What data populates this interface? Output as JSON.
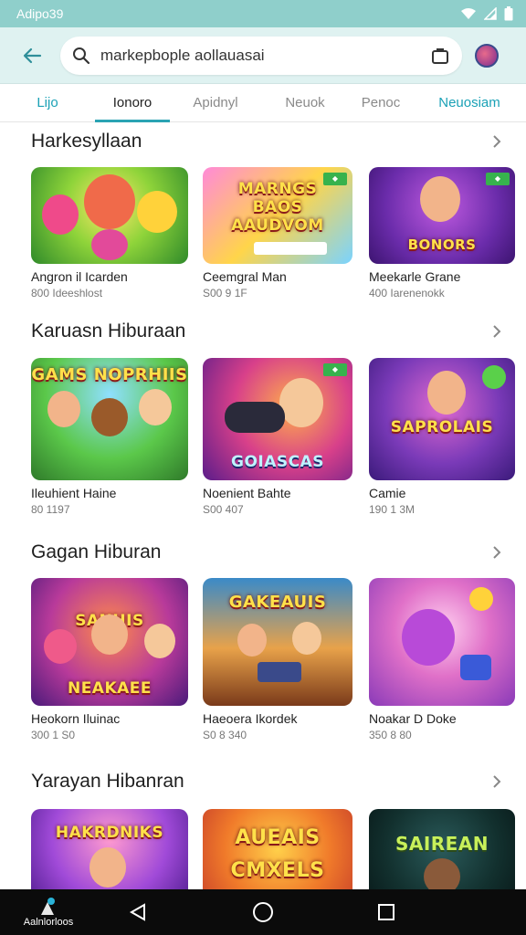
{
  "status_bar": {
    "time": "Adipo39"
  },
  "search": {
    "value": "markepbople aollauasai"
  },
  "tabs": [
    {
      "label": "Lijo"
    },
    {
      "label": "Ionoro"
    },
    {
      "label": "Apidnyl"
    },
    {
      "label": "Neuok"
    },
    {
      "label": "Penoc"
    },
    {
      "label": "Neuosiam"
    }
  ],
  "sections": [
    {
      "title": "Harkesyllaan",
      "cards": [
        {
          "thumb_text": "",
          "title": "Angron il Icarden",
          "subtitle": "800 Ideeshlost"
        },
        {
          "thumb_text": "MARNGS BAOS AAUDVOM",
          "title": "Ceemgral Man",
          "subtitle": "S00 9 1F"
        },
        {
          "thumb_text": "BONORS",
          "title": "Meekarle Grane",
          "subtitle": "400 Iarenenokk"
        }
      ]
    },
    {
      "title": "Karuasn Hiburaan",
      "cards": [
        {
          "thumb_text": "GAMS NOPRHIIS",
          "title": "Ileuhient Haine",
          "subtitle": "80 1197"
        },
        {
          "thumb_text": "GOIASCAS",
          "title": "Noenient Bahte",
          "subtitle": "S00 407"
        },
        {
          "thumb_text": "SAPROLAIS",
          "title": "Camie",
          "subtitle": "190 1 3M"
        }
      ]
    },
    {
      "title": "Gagan Hiburan",
      "cards": [
        {
          "thumb_text": "SANHIS NEAKAEE",
          "title": "Heokorn Iluinac",
          "subtitle": "300 1 S0"
        },
        {
          "thumb_text": "GAKEAUIS",
          "title": "Haeoera Ikordek",
          "subtitle": "S0 8 340"
        },
        {
          "thumb_text": "",
          "title": "Noakar D Doke",
          "subtitle": "350 8 80"
        }
      ]
    },
    {
      "title": "Yarayan Hibanran",
      "cards": [
        {
          "thumb_text": "HAKRDNIKS",
          "title": "",
          "subtitle": ""
        },
        {
          "thumb_text": "AUEAIS CMXELS",
          "title": "",
          "subtitle": ""
        },
        {
          "thumb_text": "SAIREAN",
          "title": "",
          "subtitle": ""
        }
      ]
    }
  ],
  "nav": {
    "home_label": "Aalnlorloos"
  },
  "colors": {
    "status_bar": "#8fcfcb",
    "header": "#dff2f1",
    "tab_accent": "#2aa3b3",
    "nav_bar": "#0b0b0b"
  },
  "icons": [
    "wifi-icon",
    "signal-icon",
    "battery-icon",
    "back-arrow-icon",
    "search-icon",
    "bag-icon",
    "chevron-right-icon",
    "back-triangle-icon",
    "home-circle-icon",
    "recents-square-icon"
  ]
}
